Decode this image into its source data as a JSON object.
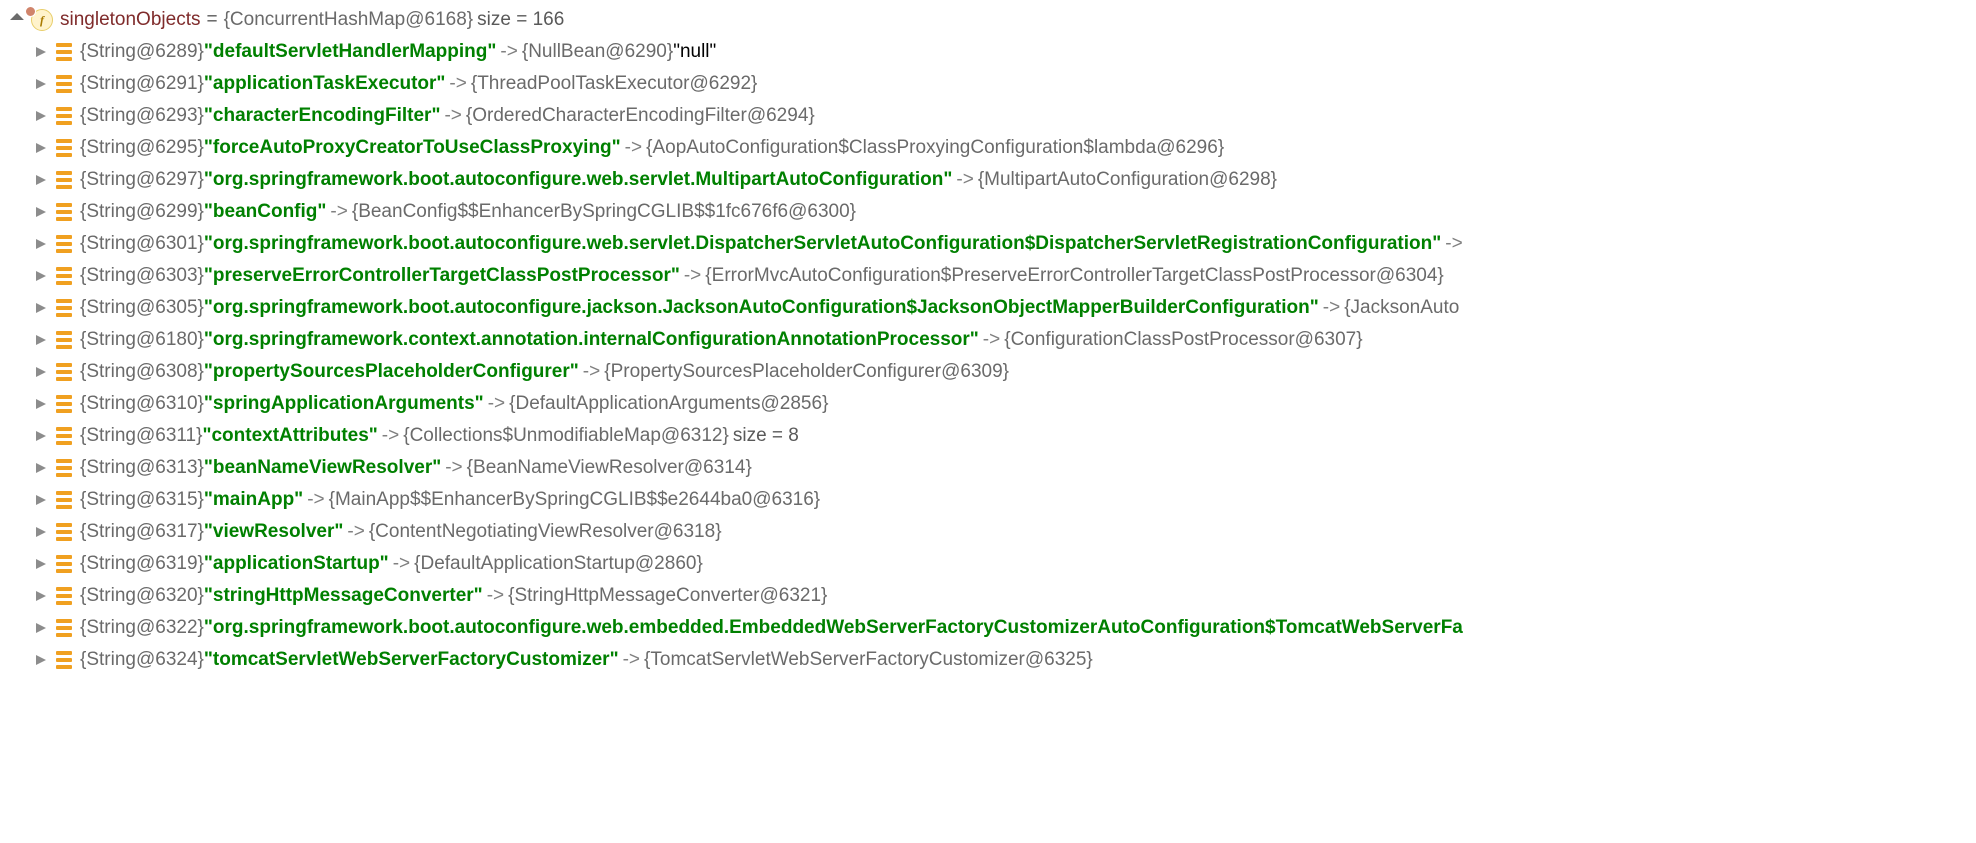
{
  "root": {
    "varName": "singletonObjects",
    "eq": " = ",
    "valueType": "{ConcurrentHashMap@6168}",
    "sizeText": "  size = 166",
    "iconLetter": "f"
  },
  "entries": [
    {
      "keyType": "{String@6289} ",
      "key": "\"defaultServletHandlerMapping\"",
      "arrow": " -> ",
      "valType": "{NullBean@6290} ",
      "valLiteral": "\"null\""
    },
    {
      "keyType": "{String@6291} ",
      "key": "\"applicationTaskExecutor\"",
      "arrow": " -> ",
      "valType": "{ThreadPoolTaskExecutor@6292}"
    },
    {
      "keyType": "{String@6293} ",
      "key": "\"characterEncodingFilter\"",
      "arrow": " -> ",
      "valType": "{OrderedCharacterEncodingFilter@6294}"
    },
    {
      "keyType": "{String@6295} ",
      "key": "\"forceAutoProxyCreatorToUseClassProxying\"",
      "arrow": " -> ",
      "valType": "{AopAutoConfiguration$ClassProxyingConfiguration$lambda@6296}"
    },
    {
      "keyType": "{String@6297} ",
      "key": "\"org.springframework.boot.autoconfigure.web.servlet.MultipartAutoConfiguration\"",
      "arrow": " -> ",
      "valType": "{MultipartAutoConfiguration@6298}"
    },
    {
      "keyType": "{String@6299} ",
      "key": "\"beanConfig\"",
      "arrow": " -> ",
      "valType": "{BeanConfig$$EnhancerBySpringCGLIB$$1fc676f6@6300}"
    },
    {
      "keyType": "{String@6301} ",
      "key": "\"org.springframework.boot.autoconfigure.web.servlet.DispatcherServletAutoConfiguration$DispatcherServletRegistrationConfiguration\"",
      "arrow": " ->",
      "valType": ""
    },
    {
      "keyType": "{String@6303} ",
      "key": "\"preserveErrorControllerTargetClassPostProcessor\"",
      "arrow": " -> ",
      "valType": "{ErrorMvcAutoConfiguration$PreserveErrorControllerTargetClassPostProcessor@6304}"
    },
    {
      "keyType": "{String@6305} ",
      "key": "\"org.springframework.boot.autoconfigure.jackson.JacksonAutoConfiguration$JacksonObjectMapperBuilderConfiguration\"",
      "arrow": " -> ",
      "valType": "{JacksonAuto"
    },
    {
      "keyType": "{String@6180} ",
      "key": "\"org.springframework.context.annotation.internalConfigurationAnnotationProcessor\"",
      "arrow": " -> ",
      "valType": "{ConfigurationClassPostProcessor@6307}"
    },
    {
      "keyType": "{String@6308} ",
      "key": "\"propertySourcesPlaceholderConfigurer\"",
      "arrow": " -> ",
      "valType": "{PropertySourcesPlaceholderConfigurer@6309}"
    },
    {
      "keyType": "{String@6310} ",
      "key": "\"springApplicationArguments\"",
      "arrow": " -> ",
      "valType": "{DefaultApplicationArguments@2856}"
    },
    {
      "keyType": "{String@6311} ",
      "key": "\"contextAttributes\"",
      "arrow": " -> ",
      "valType": "{Collections$UnmodifiableMap@6312}",
      "sizeText": "  size = 8"
    },
    {
      "keyType": "{String@6313} ",
      "key": "\"beanNameViewResolver\"",
      "arrow": " -> ",
      "valType": "{BeanNameViewResolver@6314}"
    },
    {
      "keyType": "{String@6315} ",
      "key": "\"mainApp\"",
      "arrow": " -> ",
      "valType": "{MainApp$$EnhancerBySpringCGLIB$$e2644ba0@6316}"
    },
    {
      "keyType": "{String@6317} ",
      "key": "\"viewResolver\"",
      "arrow": " -> ",
      "valType": "{ContentNegotiatingViewResolver@6318}"
    },
    {
      "keyType": "{String@6319} ",
      "key": "\"applicationStartup\"",
      "arrow": " -> ",
      "valType": "{DefaultApplicationStartup@2860}"
    },
    {
      "keyType": "{String@6320} ",
      "key": "\"stringHttpMessageConverter\"",
      "arrow": " -> ",
      "valType": "{StringHttpMessageConverter@6321}"
    },
    {
      "keyType": "{String@6322} ",
      "key": "\"org.springframework.boot.autoconfigure.web.embedded.EmbeddedWebServerFactoryCustomizerAutoConfiguration$TomcatWebServerFa",
      "arrow": "",
      "valType": ""
    },
    {
      "keyType": "{String@6324} ",
      "key": "\"tomcatServletWebServerFactoryCustomizer\"",
      "arrow": " -> ",
      "valType": "{TomcatServletWebServerFactoryCustomizer@6325}"
    }
  ]
}
